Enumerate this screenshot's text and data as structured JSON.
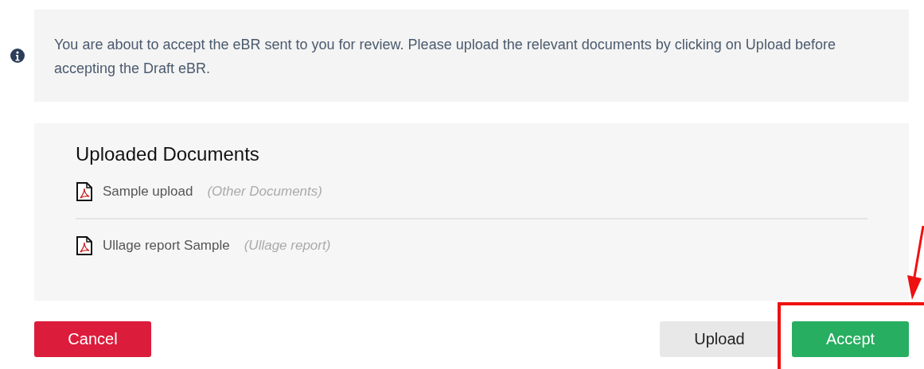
{
  "notice": {
    "text": "You are about to accept the eBR sent to you for review. Please upload the relevant documents by clicking on Upload before accepting the Draft eBR."
  },
  "documents": {
    "title": "Uploaded Documents",
    "items": [
      {
        "name": "Sample upload",
        "category": "(Other Documents)"
      },
      {
        "name": "Ullage report Sample",
        "category": "(Ullage report)"
      }
    ]
  },
  "buttons": [
    {
      "label": "Cancel",
      "kind": "danger"
    },
    {
      "label": "Upload",
      "kind": "default"
    },
    {
      "label": "Accept",
      "kind": "success"
    }
  ]
}
